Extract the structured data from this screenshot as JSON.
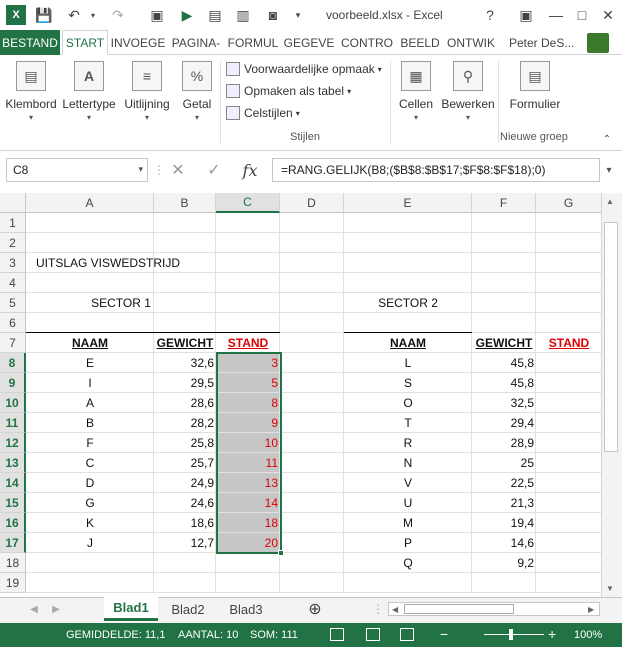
{
  "window": {
    "title": "voorbeeld.xlsx - Excel",
    "app_icon": "excel-icon",
    "help": "?",
    "min": "—",
    "restore": "□",
    "close": "✕"
  },
  "qat": {
    "save": "💾",
    "undo": "↶",
    "redo": "↷"
  },
  "tabs": [
    "BESTAND",
    "START",
    "INVOEGE",
    "PAGINA-",
    "FORMUL",
    "GEGEVE",
    "CONTRO",
    "BEELD",
    "ONTWIK"
  ],
  "user": "Peter DeS...",
  "ribbon": {
    "klembord": "Klembord",
    "lettertype": "Lettertype",
    "uitlijning": "Uitlijning",
    "getal": "Getal",
    "voorwaardelijk": "Voorwaardelijke opmaak",
    "opmaken_tabel": "Opmaken als tabel",
    "celstijlen": "Celstijlen",
    "stijlen": "Stijlen",
    "cellen": "Cellen",
    "bewerken": "Bewerken",
    "formulier": "Formulier",
    "nieuwe_groep": "Nieuwe groep"
  },
  "formula_bar": {
    "name_box": "C8",
    "formula": "=RANG.GELIJK(B8;($B$8:$B$17;$F$8:$F$18);0)",
    "fx": "fx"
  },
  "columns": [
    "A",
    "B",
    "C",
    "D",
    "E",
    "F",
    "G"
  ],
  "rows": [
    "1",
    "2",
    "3",
    "4",
    "5",
    "6",
    "7",
    "8",
    "9",
    "10",
    "11",
    "12",
    "13",
    "14",
    "15",
    "16",
    "17",
    "18",
    "19"
  ],
  "sheet": {
    "title": "UITSLAG VISWEDSTRIJD",
    "sector1": "SECTOR 1",
    "sector2": "SECTOR 2",
    "header_naam": "NAAM",
    "header_gewicht": "GEWICHT",
    "header_stand": "STAND",
    "sector1_rows": [
      {
        "naam": "E",
        "gewicht": "32,6",
        "stand": "3"
      },
      {
        "naam": "I",
        "gewicht": "29,5",
        "stand": "5"
      },
      {
        "naam": "A",
        "gewicht": "28,6",
        "stand": "8"
      },
      {
        "naam": "B",
        "gewicht": "28,2",
        "stand": "9"
      },
      {
        "naam": "F",
        "gewicht": "25,8",
        "stand": "10"
      },
      {
        "naam": "C",
        "gewicht": "25,7",
        "stand": "11"
      },
      {
        "naam": "D",
        "gewicht": "24,9",
        "stand": "13"
      },
      {
        "naam": "G",
        "gewicht": "24,6",
        "stand": "14"
      },
      {
        "naam": "K",
        "gewicht": "18,6",
        "stand": "18"
      },
      {
        "naam": "J",
        "gewicht": "12,7",
        "stand": "20"
      }
    ],
    "sector2_rows": [
      {
        "naam": "L",
        "gewicht": "45,8"
      },
      {
        "naam": "S",
        "gewicht": "45,8"
      },
      {
        "naam": "O",
        "gewicht": "32,5"
      },
      {
        "naam": "T",
        "gewicht": "29,4"
      },
      {
        "naam": "R",
        "gewicht": "28,9"
      },
      {
        "naam": "N",
        "gewicht": "25"
      },
      {
        "naam": "V",
        "gewicht": "22,5"
      },
      {
        "naam": "U",
        "gewicht": "21,3"
      },
      {
        "naam": "M",
        "gewicht": "19,4"
      },
      {
        "naam": "P",
        "gewicht": "14,6"
      },
      {
        "naam": "Q",
        "gewicht": "9,2"
      }
    ]
  },
  "sheet_tabs": [
    "Blad1",
    "Blad2",
    "Blad3"
  ],
  "add_sheet": "⊕",
  "status": {
    "gemiddelde": "GEMIDDELDE: 11,1",
    "aantal": "AANTAL: 10",
    "som": "SOM: 111",
    "zoom_minus": "−",
    "zoom_plus": "+",
    "zoom": "100%"
  },
  "colors": {
    "accent": "#217346",
    "stand_red": "#dd0000",
    "selection_gray": "#c6c6c6"
  }
}
